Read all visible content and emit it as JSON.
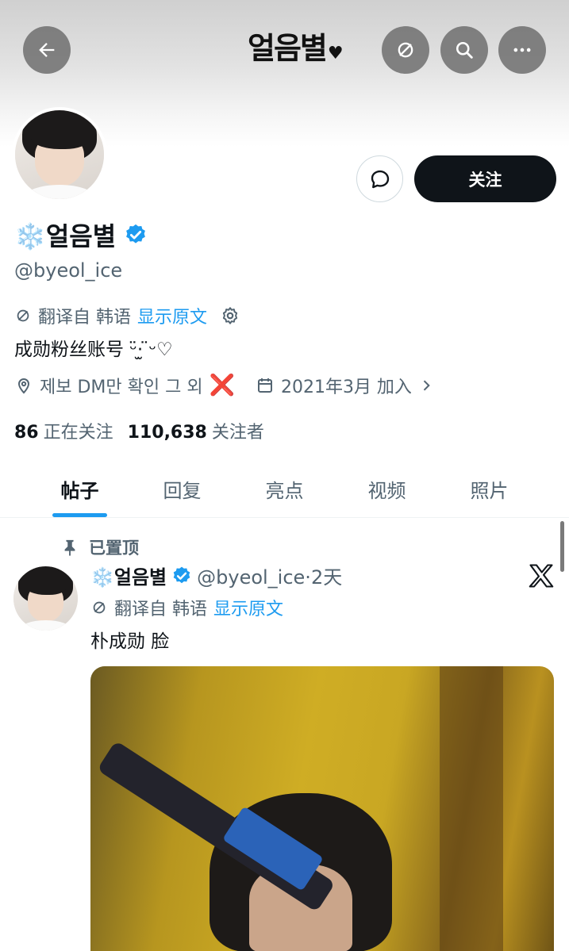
{
  "header": {
    "logo_text": "얼음별",
    "back_icon": "arrow-left-icon",
    "icons": [
      "translate-icon",
      "search-icon",
      "more-icon"
    ]
  },
  "profile": {
    "display_name": "❄️얼음별",
    "handle": "@byeol_ice",
    "follow_label": "关注",
    "translate": {
      "prefix": "翻译自 韩语",
      "link": "显示原文"
    },
    "bio": "成勋粉丝账号 ᵕ̈·̫ ̈ᵕ♡",
    "location": "제보 DM만 확인 그 외",
    "location_mark": "❌",
    "joined": "2021年3月 加入",
    "following_count": "86",
    "following_label": "正在关注",
    "followers_count": "110,638",
    "followers_label": "关注者"
  },
  "tabs": [
    {
      "label": "帖子",
      "active": true
    },
    {
      "label": "回复"
    },
    {
      "label": "亮点"
    },
    {
      "label": "视频"
    },
    {
      "label": "照片"
    }
  ],
  "post": {
    "pinned_label": "已置顶",
    "name": "❄️얼음별",
    "handle_time": "@byeol_ice·2天",
    "translate_prefix": "翻译自 韩语",
    "translate_link": "显示原文",
    "text": "朴成勋 脸"
  },
  "colors": {
    "accent": "#1d9bf0",
    "text": "#0f1419",
    "muted": "#536471",
    "follow_bg": "#0f1419"
  }
}
